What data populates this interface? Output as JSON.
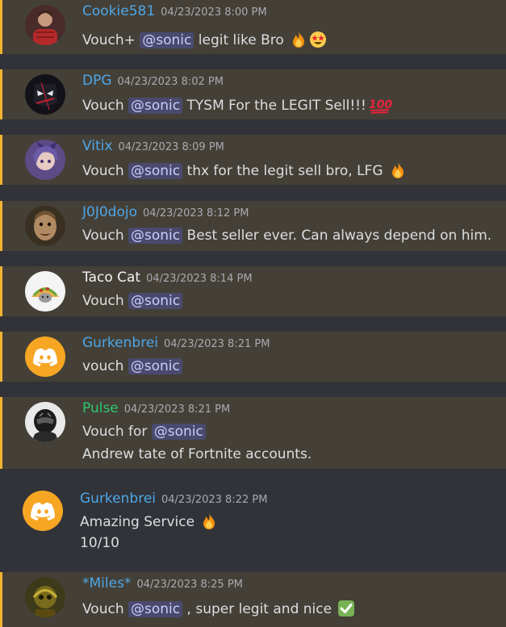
{
  "colors": {
    "background": "#313338",
    "highlight_background": "#444037",
    "highlight_border": "#f0b232",
    "text": "#dbdee1",
    "timestamp": "#a9aab1",
    "mention_bg": "#45487a",
    "mention_text": "#c9cdfb",
    "username_blue": "#4ea6e8",
    "username_white": "#f2f3f5",
    "username_green": "#2dc770",
    "discord_orange": "#f6a623"
  },
  "messages": [
    {
      "username": "Cookie581",
      "timestamp": "04/23/2023 8:00 PM",
      "line1_pre": "Vouch+",
      "mention": "@sonic",
      "line1_post": "legit like Bro",
      "emojis": [
        "fire-icon",
        "star-struck-icon"
      ]
    },
    {
      "username": "DPG",
      "timestamp": "04/23/2023 8:02 PM",
      "line1_pre": "Vouch",
      "mention": "@sonic",
      "line1_post": "TYSM For the LEGIT Sell!!!",
      "emojis": [
        "hundred-points-icon"
      ]
    },
    {
      "username": "Vitix",
      "timestamp": "04/23/2023 8:09 PM",
      "line1_pre": "Vouch",
      "mention": "@sonic",
      "line1_post": "thx for the legit sell bro, LFG",
      "emojis": [
        "fire-icon"
      ]
    },
    {
      "username": "J0J0dojo",
      "timestamp": "04/23/2023 8:12 PM",
      "line1_pre": "Vouch",
      "mention": "@sonic",
      "line1_post": "Best seller ever. Can always depend on him."
    },
    {
      "username": "Taco Cat",
      "timestamp": "04/23/2023 8:14 PM",
      "line1_pre": "Vouch",
      "mention": "@sonic"
    },
    {
      "username": "Gurkenbrei",
      "timestamp": "04/23/2023 8:21 PM",
      "line1_pre": "vouch",
      "mention": "@sonic"
    },
    {
      "username": "Pulse",
      "timestamp": "04/23/2023 8:21 PM",
      "line1_pre": "Vouch for",
      "mention": "@sonic",
      "line2": "Andrew tate of Fortnite accounts."
    },
    {
      "username": "Gurkenbrei",
      "timestamp": "04/23/2023 8:22 PM",
      "line1_pre": "Amazing Service",
      "line2": "10/10",
      "emojis": [
        "fire-icon"
      ]
    },
    {
      "username": "*Miles*",
      "timestamp": "04/23/2023 8:25 PM",
      "line1_pre": "Vouch",
      "mention": "@sonic",
      "line1_post": ", super legit and nice",
      "emojis": [
        "check-mark-icon"
      ]
    }
  ]
}
